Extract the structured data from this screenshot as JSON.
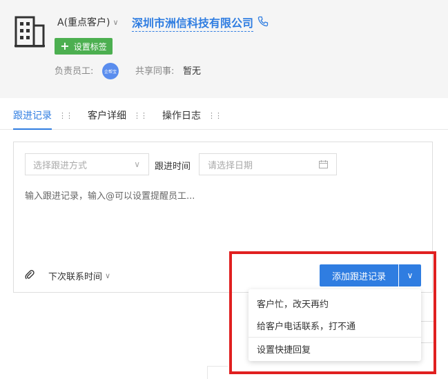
{
  "header": {
    "level": "A(重点客户)",
    "company_name": "深圳市洲信科技有限公司",
    "tag_button": "设置标签",
    "owner_label": "负责员工:",
    "owner_avatar": "企帮宝",
    "share_label": "共享同事:",
    "share_value": "暂无"
  },
  "tabs": [
    {
      "label": "跟进记录",
      "active": true
    },
    {
      "label": "客户详细",
      "active": false
    },
    {
      "label": "操作日志",
      "active": false
    }
  ],
  "editor": {
    "method_placeholder": "选择跟进方式",
    "time_label": "跟进时间",
    "date_placeholder": "请选择日期",
    "content_placeholder": "输入跟进记录，输入@可以设置提醒员工...",
    "next_contact": "下次联系时间",
    "submit_button": "添加跟进记录"
  },
  "quick_reply_menu": {
    "items": [
      "客户忙，改天再约",
      "给客户电话联系，打不通"
    ],
    "settings": "设置快捷回复"
  },
  "colors": {
    "accent": "#2f7de1",
    "tag": "#4caf50",
    "highlight": "#e02020"
  }
}
